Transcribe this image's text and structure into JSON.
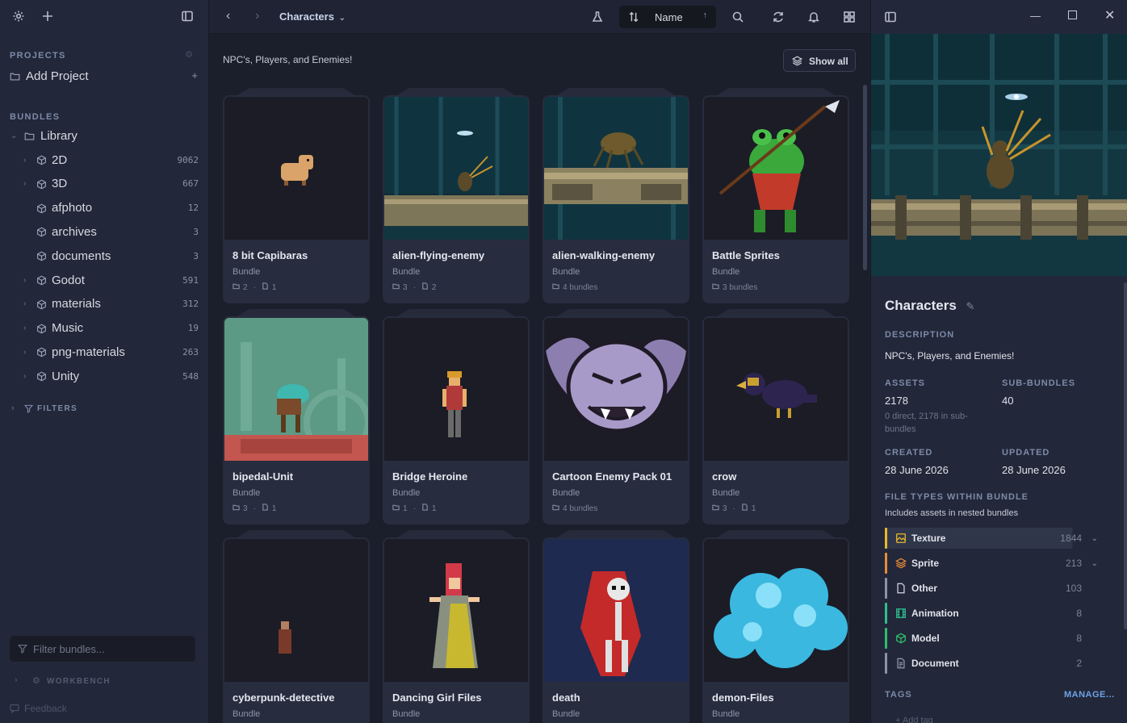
{
  "sidebar": {
    "projects_label": "PROJECTS",
    "add_project": "Add Project",
    "bundles_label": "BUNDLES",
    "library": "Library",
    "items": [
      {
        "label": "2D",
        "count": "9062",
        "expandable": true
      },
      {
        "label": "3D",
        "count": "667",
        "expandable": true
      },
      {
        "label": "afphoto",
        "count": "12",
        "expandable": false
      },
      {
        "label": "archives",
        "count": "3",
        "expandable": false
      },
      {
        "label": "documents",
        "count": "3",
        "expandable": false
      },
      {
        "label": "Godot",
        "count": "591",
        "expandable": true
      },
      {
        "label": "materials",
        "count": "312",
        "expandable": true
      },
      {
        "label": "Music",
        "count": "19",
        "expandable": true
      },
      {
        "label": "png-materials",
        "count": "263",
        "expandable": true
      },
      {
        "label": "Unity",
        "count": "548",
        "expandable": true
      }
    ],
    "filters_label": "FILTERS",
    "filter_placeholder": "Filter bundles...",
    "workbench_label": "WORKBENCH",
    "feedback": "Feedback"
  },
  "topbar": {
    "breadcrumb": "Characters",
    "sort_label": "Name"
  },
  "main": {
    "description": "NPC's, Players, and Enemies!",
    "show_all": "Show all",
    "cards": [
      {
        "title": "8 bit Capibaras",
        "kind": "Bundle",
        "bundles": "2",
        "files": "1",
        "thumb": "capybara"
      },
      {
        "title": "alien-flying-enemy",
        "kind": "Bundle",
        "bundles": "3",
        "files": "2",
        "thumb": "flying"
      },
      {
        "title": "alien-walking-enemy",
        "kind": "Bundle",
        "bundles_text": "4 bundles",
        "thumb": "walking"
      },
      {
        "title": "Battle Sprites",
        "kind": "Bundle",
        "bundles_text": "3 bundles",
        "thumb": "frog"
      },
      {
        "title": "bipedal-Unit",
        "kind": "Bundle",
        "bundles": "3",
        "files": "1",
        "thumb": "bipedal"
      },
      {
        "title": "Bridge Heroine",
        "kind": "Bundle",
        "bundles": "1",
        "files": "1",
        "thumb": "heroine"
      },
      {
        "title": "Cartoon Enemy Pack 01",
        "kind": "Bundle",
        "bundles_text": "4 bundles",
        "thumb": "bat"
      },
      {
        "title": "crow",
        "kind": "Bundle",
        "bundles": "3",
        "files": "1",
        "thumb": "crow"
      },
      {
        "title": "cyberpunk-detective",
        "kind": "Bundle",
        "thumb": "detective"
      },
      {
        "title": "Dancing Girl Files",
        "kind": "Bundle",
        "thumb": "dancer"
      },
      {
        "title": "death",
        "kind": "Bundle",
        "thumb": "death"
      },
      {
        "title": "demon-Files",
        "kind": "Bundle",
        "thumb": "demon"
      }
    ]
  },
  "details": {
    "title": "Characters",
    "description_label": "DESCRIPTION",
    "description": "NPC's, Players, and Enemies!",
    "assets_label": "ASSETS",
    "assets": "2178",
    "assets_note": "0 direct, 2178 in sub-bundles",
    "subbundles_label": "SUB-BUNDLES",
    "subbundles": "40",
    "created_label": "CREATED",
    "created": "28 June 2026",
    "updated_label": "UPDATED",
    "updated": "28 June 2026",
    "filetypes_label": "FILE TYPES WITHIN BUNDLE",
    "filetypes_note": "Includes assets in nested bundles",
    "filetypes": [
      {
        "name": "Texture",
        "count": "1844",
        "color": "#e8b92a",
        "expandable": true
      },
      {
        "name": "Sprite",
        "count": "213",
        "color": "#e88a3a",
        "expandable": true
      },
      {
        "name": "Other",
        "count": "103",
        "color": "#8d93a5",
        "expandable": false
      },
      {
        "name": "Animation",
        "count": "8",
        "color": "#2fbf8f",
        "expandable": false
      },
      {
        "name": "Model",
        "count": "8",
        "color": "#2fbf6a",
        "expandable": false
      },
      {
        "name": "Document",
        "count": "2",
        "color": "#8d93a5",
        "expandable": false
      }
    ],
    "tags_label": "TAGS",
    "manage": "MANAGE...",
    "add_tag": "+ Add tag"
  },
  "colors": {
    "accent": "#6ea2e6",
    "background": "#1b1e2b",
    "panel": "#222739",
    "card": "#272c3e"
  }
}
